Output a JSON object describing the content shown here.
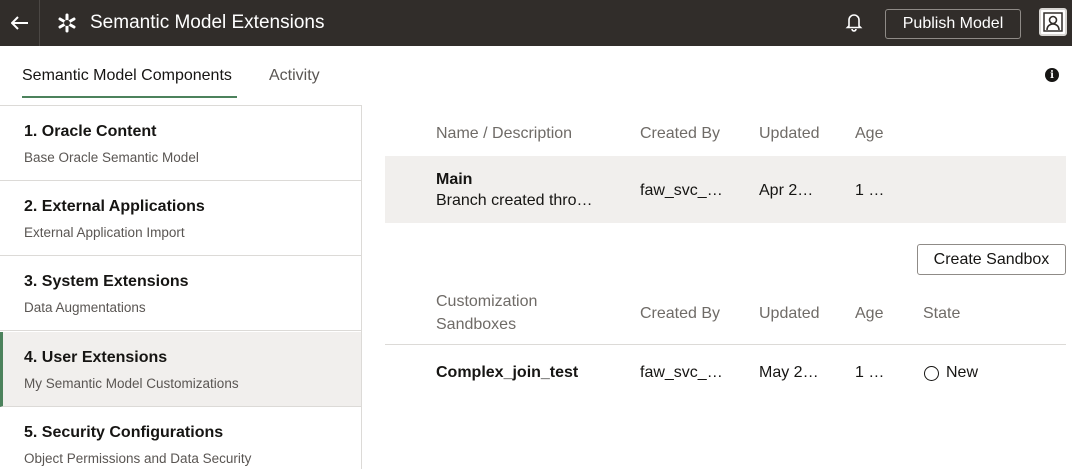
{
  "header": {
    "title": "Semantic Model Extensions",
    "publish_label": "Publish Model",
    "icons": {
      "back": "back-arrow-icon",
      "app": "asterisk-gear-icon",
      "notifications": "bell-icon",
      "profile": "user-avatar-icon"
    }
  },
  "tabs": [
    {
      "label": "Semantic Model Components",
      "selected": true
    },
    {
      "label": "Activity",
      "selected": false
    }
  ],
  "info_glyph": "i",
  "sidebar": {
    "items": [
      {
        "title": "1. Oracle Content",
        "subtitle": "Base Oracle Semantic Model"
      },
      {
        "title": "2. External Applications",
        "subtitle": "External Application Import"
      },
      {
        "title": "3. System Extensions",
        "subtitle": "Data Augmentations"
      },
      {
        "title": "4. User Extensions",
        "subtitle": "My Semantic Model Customizations",
        "active": true
      },
      {
        "title": "5. Security Configurations",
        "subtitle": "Object Permissions and Data Security"
      }
    ]
  },
  "branches": {
    "columns": {
      "name": "Name / Description",
      "created_by": "Created By",
      "updated": "Updated",
      "age": "Age"
    },
    "rows": [
      {
        "name": "Main",
        "description": "Branch created thro…",
        "created_by": "faw_svc_…",
        "updated": "Apr 2…",
        "age": "1 …"
      }
    ]
  },
  "sandboxes": {
    "create_label": "Create Sandbox",
    "columns": {
      "name_line1": "Customization",
      "name_line2": "Sandboxes",
      "created_by": "Created By",
      "updated": "Updated",
      "age": "Age",
      "state": "State"
    },
    "rows": [
      {
        "name": "Complex_join_test",
        "created_by": "faw_svc_…",
        "updated": "May 2…",
        "age": "1 …",
        "state": "New"
      }
    ]
  },
  "colors": {
    "header_bg": "#312d2a",
    "accent": "#4c825c",
    "row_bg": "#f1efed"
  }
}
